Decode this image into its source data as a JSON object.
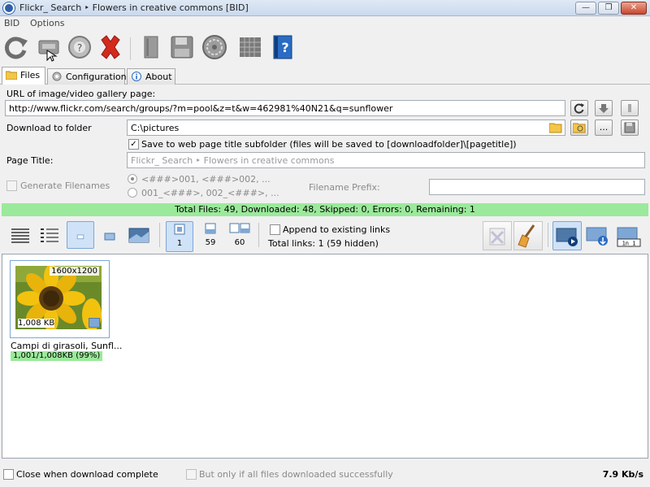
{
  "window": {
    "title": "Flickr_ Search ‣ Flowers in creative commons [BID]"
  },
  "menu": [
    "BID",
    "Options"
  ],
  "toolbar": {
    "icons": [
      "refresh-icon",
      "download-icon",
      "help-icon",
      "delete-icon",
      "book-icon",
      "save-icon",
      "settings-icon",
      "grid-icon",
      "info-icon"
    ]
  },
  "tabs": [
    {
      "label": "Files",
      "active": true
    },
    {
      "label": "Configuration",
      "active": false
    },
    {
      "label": "About",
      "active": false
    }
  ],
  "form": {
    "url_label": "URL of image/video gallery page:",
    "url_value": "http://www.flickr.com/search/groups/?m=pool&z=t&w=462981%40N21&q=sunflower",
    "folder_label": "Download to folder",
    "folder_value": "C:\\pictures",
    "subfolder_checkbox": "Save to web page title subfolder (files will be saved to [downloadfolder]\\[pagetitle])",
    "page_title_label": "Page Title:",
    "page_title_value": "Flickr_ Search ‣ Flowers in creative commons",
    "generate_filenames": "Generate Filenames",
    "radio_option_1": "<###>001, <###>002, ...",
    "radio_option_2": "001_<###>, 002_<###>, ...",
    "filename_prefix_label": "Filename Prefix:",
    "filename_prefix_value": "",
    "folder_browse": "..."
  },
  "status": {
    "summary": "Total Files: 49, Downloaded: 48, Skipped: 0, Errors: 0, Remaining: 1"
  },
  "view": {
    "count_1": "1",
    "count_59": "59",
    "count_60": "60",
    "append_label": "Append to existing links",
    "total_links": "Total links: 1 (59 hidden)"
  },
  "thumb": {
    "resolution": "1600x1200",
    "size": "1,008 KB",
    "caption": "Campi di girasoli, Sunfl...",
    "progress": "1,001/1,008KB (99%)",
    "progress_fraction": 0.99
  },
  "bottom": {
    "close_when_done": "Close when download complete",
    "only_if_success": "But only if all files downloaded successfully",
    "speed": "7.9 Kb/s"
  },
  "colors": {
    "status_green": "#9be99b",
    "accent_blue": "#7ea7d6",
    "delete_red": "#d42a1e"
  }
}
